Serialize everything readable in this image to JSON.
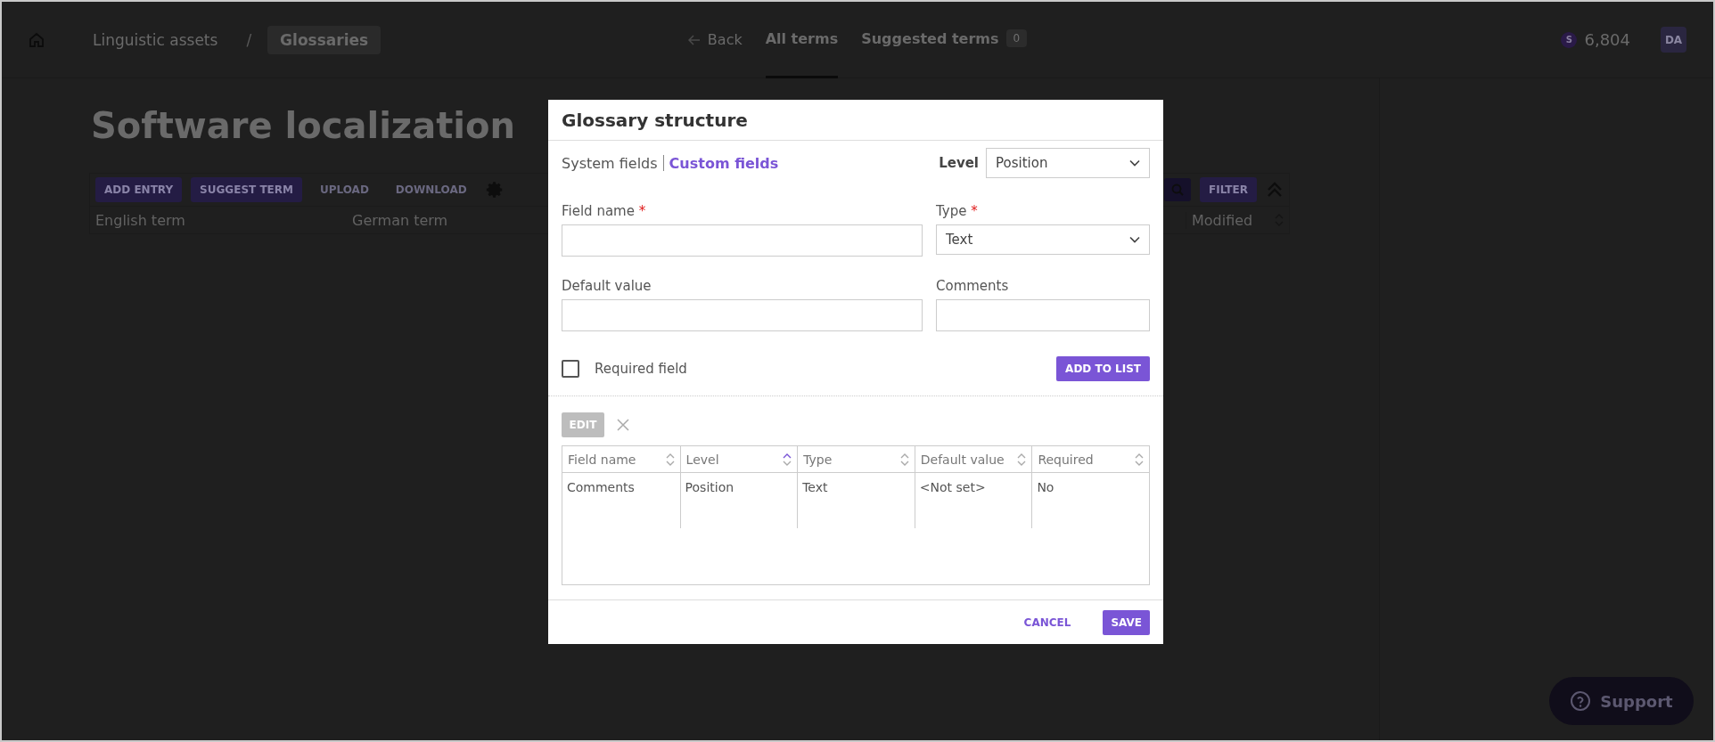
{
  "topbar": {
    "breadcrumbs": [
      {
        "label": "Linguistic assets",
        "selected": false
      },
      {
        "label": "Glossaries",
        "selected": true
      }
    ],
    "separator": "/",
    "back": "Back",
    "tabs": [
      {
        "label": "All terms",
        "selected": true
      },
      {
        "label": "Suggested terms",
        "selected": false,
        "badge": "0"
      }
    ],
    "credit_symbol": "S",
    "credits": "6,804",
    "avatar": "DA"
  },
  "page": {
    "title": "Software localization",
    "toolbar": [
      {
        "label": "ADD ENTRY",
        "kind": "filled"
      },
      {
        "label": "SUGGEST TERM",
        "kind": "filled"
      },
      {
        "label": "UPLOAD",
        "kind": "text"
      },
      {
        "label": "DOWNLOAD",
        "kind": "text"
      }
    ],
    "filter": "FILTER",
    "columns": [
      "English term",
      "German term"
    ],
    "sort_column": "Modified"
  },
  "dialog": {
    "title": "Glossary structure",
    "tabs": [
      {
        "label": "System fields",
        "selected": false
      },
      {
        "label": "Custom fields",
        "selected": true
      }
    ],
    "level_label": "Level",
    "level_value": "Position",
    "required_mark": "*",
    "fields": [
      {
        "label": "Field name",
        "required": true,
        "kind": "input"
      },
      {
        "label": "Type",
        "required": true,
        "kind": "select",
        "value": "Text"
      },
      {
        "label": "Default value",
        "required": false,
        "kind": "input"
      },
      {
        "label": "Comments",
        "required": false,
        "kind": "input"
      }
    ],
    "required_checkbox": {
      "label": "Required field",
      "checked": false
    },
    "add_button": "ADD TO LIST",
    "edit_button": {
      "label": "EDIT",
      "disabled": true
    },
    "table": {
      "columns": [
        {
          "label": "Field name",
          "sorted": false
        },
        {
          "label": "Level",
          "sorted": true
        },
        {
          "label": "Type",
          "sorted": false
        },
        {
          "label": "Default value",
          "sorted": false
        },
        {
          "label": "Required",
          "sorted": false
        }
      ],
      "rows": [
        [
          "Comments",
          "Position",
          "Text",
          "<Not set>",
          "No"
        ]
      ]
    },
    "cancel": "CANCEL",
    "save": "SAVE"
  },
  "support": "Support"
}
